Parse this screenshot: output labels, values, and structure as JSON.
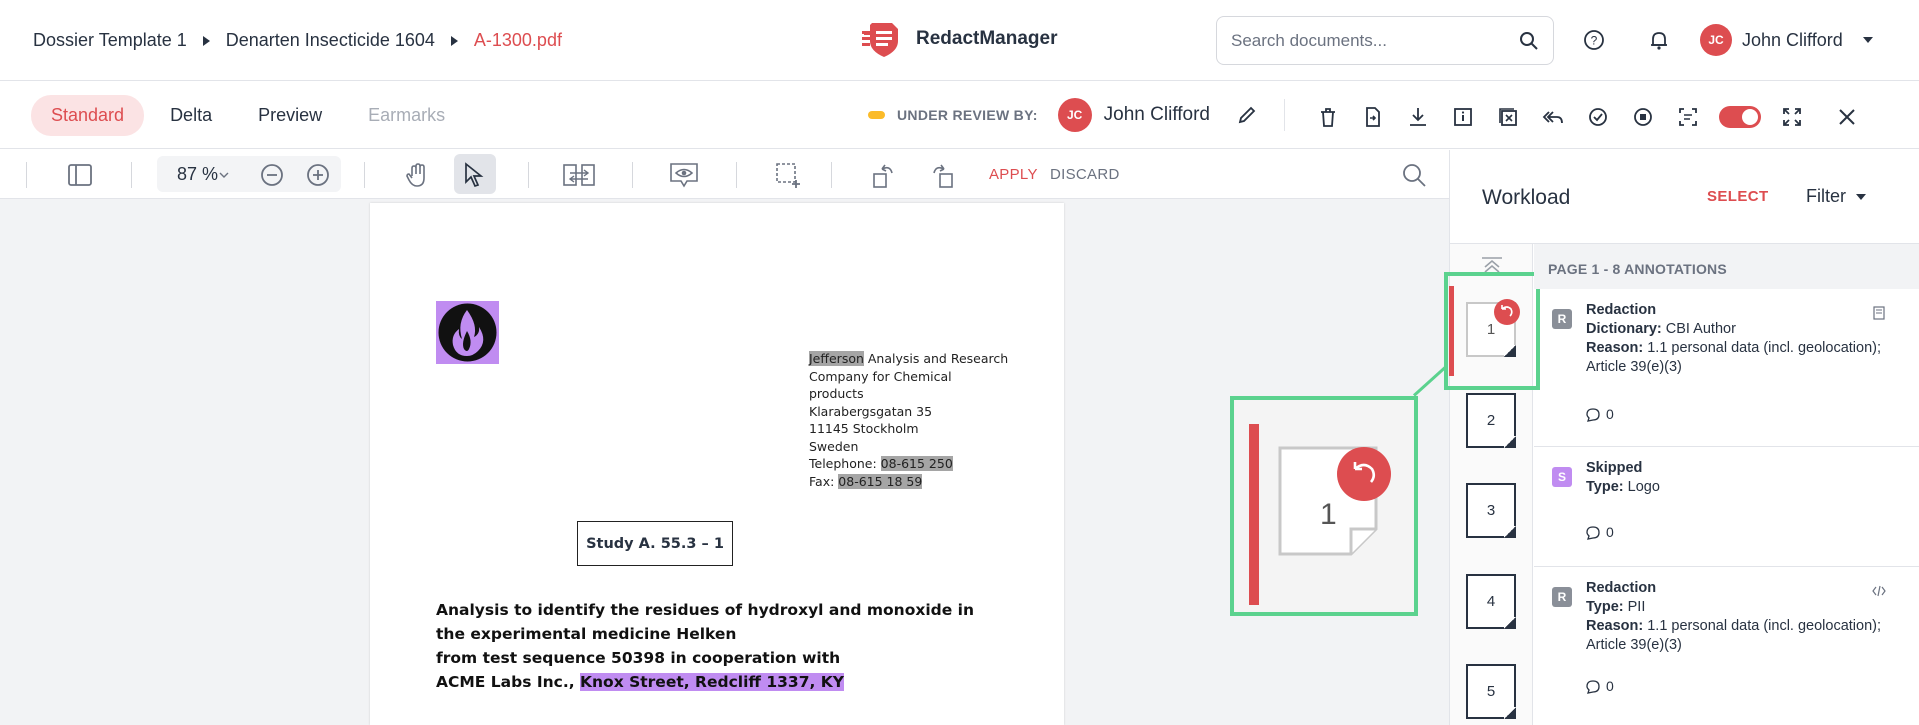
{
  "breadcrumb": {
    "items": [
      "Dossier Template 1",
      "Denarten Insecticide 1604"
    ],
    "current": "A-1300.pdf"
  },
  "brand": {
    "name": "RedactManager",
    "color": "#dd4d50"
  },
  "search": {
    "placeholder": "Search documents..."
  },
  "user": {
    "initials": "JC",
    "name": "John Clifford"
  },
  "tabs": [
    {
      "label": "Standard",
      "active": true
    },
    {
      "label": "Delta"
    },
    {
      "label": "Preview"
    },
    {
      "label": "Earmarks",
      "disabled": true
    }
  ],
  "review": {
    "label": "UNDER REVIEW BY:",
    "initials": "JC",
    "name": "John Clifford"
  },
  "toolbar": {
    "zoom": "87 %",
    "apply": "APPLY",
    "discard": "DISCARD"
  },
  "document": {
    "address": [
      {
        "hl": "Jefferson",
        "text": " Analysis and Research"
      },
      {
        "text": "Company for Chemical"
      },
      {
        "text": "products"
      },
      {
        "text": "Klarabergsgatan 35"
      },
      {
        "text": "11145 Stockholm"
      },
      {
        "text": "Sweden"
      },
      {
        "text": "Telephone: ",
        "hl2": "08-615 250"
      },
      {
        "text": "Fax: ",
        "hl2": "08-615 18 59"
      }
    ],
    "study": "Study A. 55.3 – 1",
    "para": [
      "Analysis to identify the residues of hydroxyl and monoxide in",
      "the experimental medicine Helken",
      "from test sequence 50398 in cooperation with"
    ],
    "para_last": "ACME Labs Inc., ",
    "para_hl": "Knox Street, Redcliff 1337, KY"
  },
  "callout": {
    "page": "1"
  },
  "workload": {
    "title": "Workload",
    "select": "SELECT",
    "filter": "Filter",
    "pages": [
      "1",
      "2",
      "3",
      "4",
      "5"
    ],
    "header": "PAGE 1 - 8 ANNOTATIONS",
    "annotations": [
      {
        "badge": "R",
        "badge_color": "#8a8f98",
        "title": "Redaction",
        "l1k": "Dictionary:",
        "l1v": " CBI Author",
        "l2k": "Reason:",
        "l2v": " 1.1 personal data (incl. geolocation); Article 39(e)(3)",
        "comments": "0"
      },
      {
        "badge": "S",
        "badge_color": "#c08cf1",
        "title": "Skipped",
        "l1k": "Type:",
        "l1v": " Logo",
        "comments": "0"
      },
      {
        "badge": "R",
        "badge_color": "#8a8f98",
        "title": "Redaction",
        "l1k": "Type:",
        "l1v": " PII",
        "l2k": "Reason:",
        "l2v": " 1.1 personal data (incl. geolocation); Article 39(e)(3)",
        "comments": "0"
      }
    ]
  }
}
